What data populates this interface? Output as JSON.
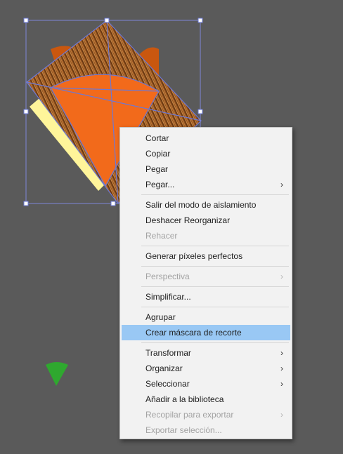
{
  "canvas": {
    "artwork": {
      "background_color": "#5a5a5a",
      "fur_color": "#8c4e1c",
      "orange_color": "#f26a1b",
      "ear_color": "#c9570f",
      "yellow_color": "#fff59a",
      "green_color": "#2fa82f",
      "selection_color": "#6b78d6"
    }
  },
  "context_menu": {
    "highlight_color": "#99c8f4",
    "items": [
      {
        "label": "Cortar",
        "disabled": false,
        "submenu": false
      },
      {
        "label": "Copiar",
        "disabled": false,
        "submenu": false
      },
      {
        "label": "Pegar",
        "disabled": false,
        "submenu": false
      },
      {
        "label": "Pegar...",
        "disabled": false,
        "submenu": true
      },
      {
        "separator": true
      },
      {
        "label": "Salir del modo de aislamiento",
        "disabled": false,
        "submenu": false
      },
      {
        "label": "Deshacer Reorganizar",
        "disabled": false,
        "submenu": false
      },
      {
        "label": "Rehacer",
        "disabled": true,
        "submenu": false
      },
      {
        "separator": true
      },
      {
        "label": "Generar píxeles perfectos",
        "disabled": false,
        "submenu": false
      },
      {
        "separator": true
      },
      {
        "label": "Perspectiva",
        "disabled": true,
        "submenu": true
      },
      {
        "separator": true
      },
      {
        "label": "Simplificar...",
        "disabled": false,
        "submenu": false
      },
      {
        "separator": true
      },
      {
        "label": "Agrupar",
        "disabled": false,
        "submenu": false
      },
      {
        "label": "Crear máscara de recorte",
        "disabled": false,
        "submenu": false,
        "highlighted": true
      },
      {
        "separator": true
      },
      {
        "label": "Transformar",
        "disabled": false,
        "submenu": true
      },
      {
        "label": "Organizar",
        "disabled": false,
        "submenu": true
      },
      {
        "label": "Seleccionar",
        "disabled": false,
        "submenu": true
      },
      {
        "label": "Añadir a la biblioteca",
        "disabled": false,
        "submenu": false
      },
      {
        "label": "Recopilar para exportar",
        "disabled": true,
        "submenu": true
      },
      {
        "label": "Exportar selección...",
        "disabled": true,
        "submenu": false
      }
    ]
  }
}
